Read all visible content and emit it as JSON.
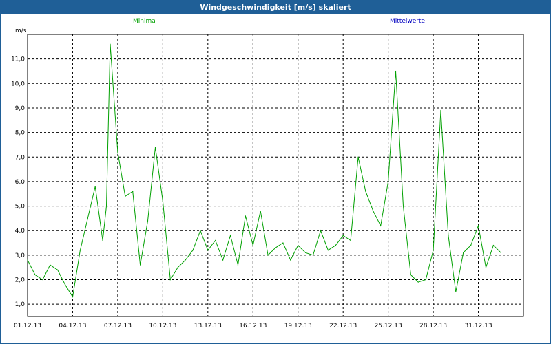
{
  "window": {
    "title": "Windgeschwindigkeit [m/s] skaliert"
  },
  "legend": [
    {
      "label": "Minima",
      "color": "#00a000"
    },
    {
      "label": "Mittelwerte",
      "color": "#0000c0"
    }
  ],
  "chart_data": {
    "type": "line",
    "title": "Windgeschwindigkeit [m/s] skaliert",
    "ylabel": "m/s",
    "xlabel": "",
    "ylim": [
      0.5,
      12.0
    ],
    "xlim": [
      "01.12.13",
      "03.01.14"
    ],
    "yticks": [
      1.0,
      2.0,
      3.0,
      4.0,
      5.0,
      6.0,
      7.0,
      8.0,
      9.0,
      10.0,
      11.0
    ],
    "ytick_labels": [
      "1,0",
      "2,0",
      "3,0",
      "4,0",
      "5,0",
      "6,0",
      "7,0",
      "8,0",
      "9,0",
      "10,0",
      "11,0"
    ],
    "xtick_labels": [
      "01.12.13",
      "04.12.13",
      "07.12.13",
      "10.12.13",
      "13.12.13",
      "16.12.13",
      "19.12.13",
      "22.12.13",
      "25.12.13",
      "28.12.13",
      "31.12.13"
    ],
    "grid": true,
    "series": [
      {
        "name": "Minima",
        "color": "#00a000",
        "x": [
          "01.12.13 00:00",
          "01.12.13 12:00",
          "02.12.13 00:00",
          "02.12.13 12:00",
          "03.12.13 00:00",
          "03.12.13 12:00",
          "04.12.13 00:00",
          "04.12.13 12:00",
          "05.12.13 00:00",
          "05.12.13 12:00",
          "06.12.13 00:00",
          "06.12.13 06:00",
          "06.12.13 12:00",
          "07.12.13 00:00",
          "07.12.13 12:00",
          "08.12.13 00:00",
          "08.12.13 12:00",
          "09.12.13 00:00",
          "09.12.13 12:00",
          "10.12.13 00:00",
          "10.12.13 12:00",
          "11.12.13 00:00",
          "11.12.13 12:00",
          "12.12.13 00:00",
          "12.12.13 12:00",
          "13.12.13 00:00",
          "13.12.13 12:00",
          "14.12.13 00:00",
          "14.12.13 12:00",
          "15.12.13 00:00",
          "15.12.13 12:00",
          "16.12.13 00:00",
          "16.12.13 12:00",
          "17.12.13 00:00",
          "17.12.13 12:00",
          "18.12.13 00:00",
          "18.12.13 12:00",
          "19.12.13 00:00",
          "19.12.13 12:00",
          "20.12.13 00:00",
          "20.12.13 12:00",
          "21.12.13 00:00",
          "21.12.13 12:00",
          "22.12.13 00:00",
          "22.12.13 12:00",
          "23.12.13 00:00",
          "23.12.13 12:00",
          "24.12.13 00:00",
          "24.12.13 12:00",
          "25.12.13 00:00",
          "25.12.13 12:00",
          "26.12.13 00:00",
          "26.12.13 12:00",
          "27.12.13 00:00",
          "27.12.13 12:00",
          "28.12.13 00:00",
          "28.12.13 12:00",
          "29.12.13 00:00",
          "29.12.13 12:00",
          "30.12.13 00:00",
          "30.12.13 12:00",
          "31.12.13 00:00",
          "31.12.13 12:00",
          "01.01.14 00:00",
          "01.01.14 12:00"
        ],
        "values": [
          2.8,
          2.2,
          2.0,
          2.6,
          2.4,
          1.8,
          1.3,
          3.2,
          4.5,
          5.8,
          3.6,
          5.0,
          11.6,
          7.2,
          5.4,
          5.6,
          2.6,
          4.4,
          7.4,
          5.2,
          2.0,
          2.5,
          2.8,
          3.2,
          4.0,
          3.2,
          3.6,
          2.8,
          3.8,
          2.6,
          4.6,
          3.4,
          4.8,
          3.0,
          3.3,
          3.5,
          2.8,
          3.4,
          3.1,
          3.0,
          4.0,
          3.2,
          3.4,
          3.8,
          3.6,
          7.0,
          5.6,
          4.8,
          4.2,
          6.0,
          10.5,
          5.0,
          2.2,
          1.9,
          2.0,
          3.2,
          8.9,
          3.8,
          1.5,
          3.1,
          3.4,
          4.2,
          2.5,
          3.4,
          3.1
        ]
      }
    ]
  }
}
